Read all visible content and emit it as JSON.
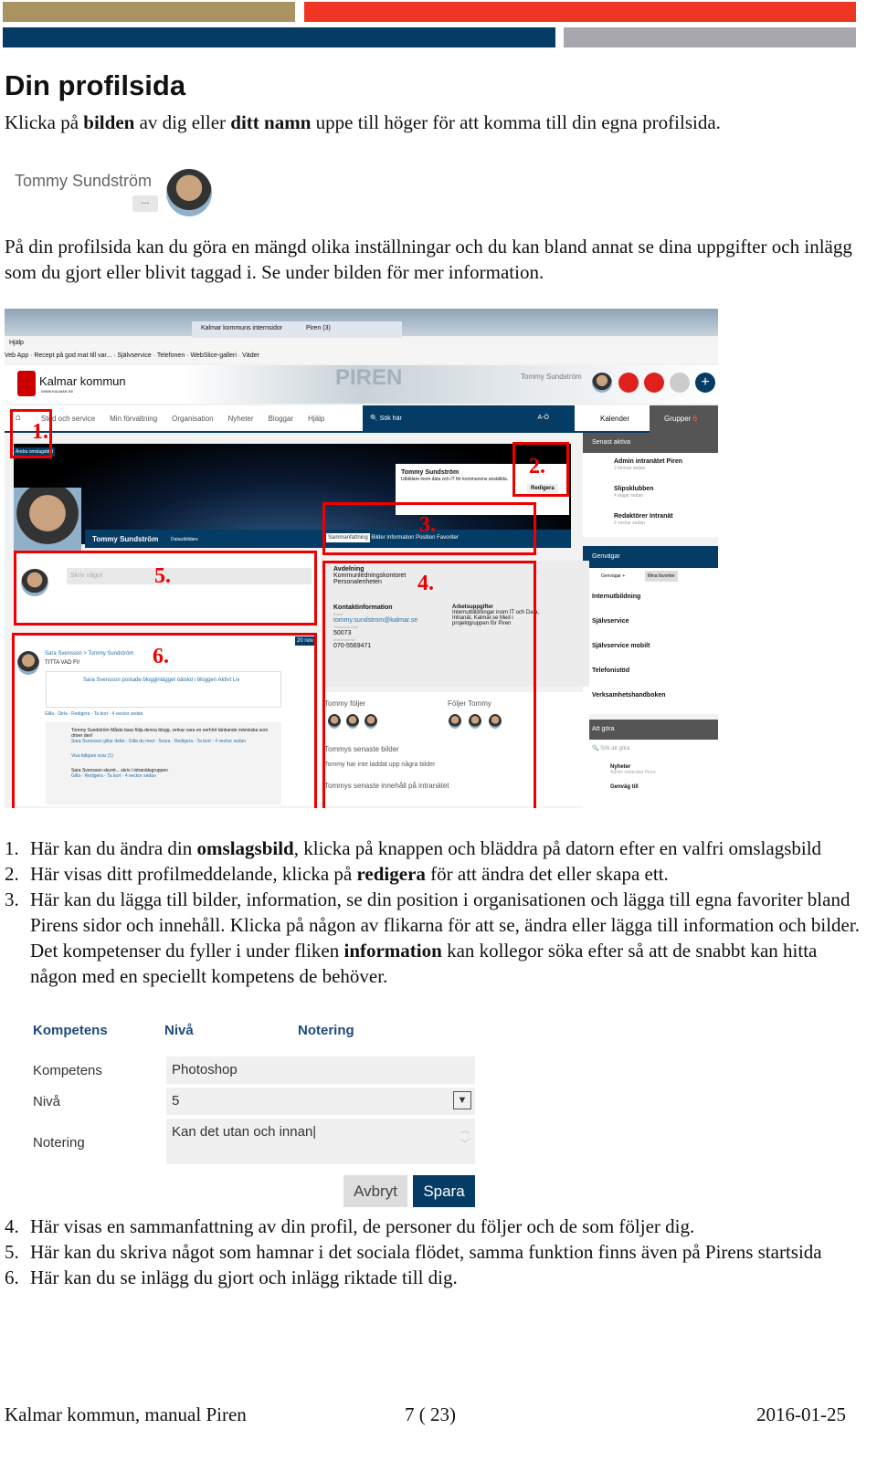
{
  "header_colors": {
    "gold": "#a89361",
    "red": "#ef3524",
    "navy": "#043c66",
    "gray": "#a7a7ad"
  },
  "title": "Din profilsida",
  "intro": {
    "p1": "Klicka på ",
    "b1": "bilden",
    "p2": " av dig eller ",
    "b2": "ditt namn",
    "p3": " uppe till höger för att komma till din egna profilsida."
  },
  "user_chip": {
    "name": "Tommy Sundström",
    "more": "..."
  },
  "para2": "På din profilsida kan du göra en mängd olika inställningar och du kan bland annat se dina uppgifter och inlägg som du gjort eller blivit taggad i. Se under bilden för mer information.",
  "screenshot": {
    "browser_tabs": [
      "Kalmar kommuns internsidor",
      "Piren (3)"
    ],
    "menu": "Hjälp",
    "favorites": [
      "Veb App",
      "Recept på god mat till var...",
      "Självservice",
      "Telefonen",
      "WebSlice-galleri",
      "Väder"
    ],
    "logo": "Kalmar kommun",
    "logo_sub": "WWW.KALMAR.SE",
    "banner": "PIREN",
    "user": "Tommy Sundström",
    "badges": [
      "7",
      "3"
    ],
    "nav": [
      "Stöd och service",
      "Min förvaltning",
      "Organisation",
      "Nyheter",
      "Bloggar",
      "Hjälp"
    ],
    "search": "Sök här",
    "ao": "A-Ö",
    "right_tabs": [
      "Kalender",
      "Grupper"
    ],
    "groups_badge": "6",
    "cover_button": "Ändra omslagsbild",
    "profile_name": "Tommy Sundström",
    "profile_title": "Datautbildare",
    "status_text": "Utbildare inom data och IT för kommunens anställda.",
    "edit": "Redigera",
    "tabs": [
      "Sammanfattning",
      "Bilder",
      "Information",
      "Position",
      "Favoriter"
    ],
    "recent_title": "Senast aktiva",
    "recent": [
      {
        "name": "Admin intranätet Piren",
        "time": "2 timmar sedan"
      },
      {
        "name": "Slipsklubben",
        "time": "4 dagar sedan"
      },
      {
        "name": "Redaktörer Intranät",
        "time": "2 veckor sedan"
      }
    ],
    "shortcuts_title": "Genvägar",
    "shortcut_tabs": [
      "Genvägar",
      "Mina favoriter"
    ],
    "shortcuts": [
      "Internutbildning",
      "Självservice",
      "Självservice mobilt",
      "Telefonistöd",
      "Verksamhetshandboken"
    ],
    "todo_title": "Att göra",
    "todo_search": "Sök att göra",
    "todo_item": "Nyheter",
    "todo_sub": "Admin intranätet Piren",
    "todo_more": "Genväg till",
    "write_placeholder": "Skriv något",
    "post_date": "20 nov",
    "post_author": "Sara Svensson > Tommy Sundström",
    "post_text": "TITTA VAD FI!",
    "shared": "Sara Svensson postade blogginlägget öälskd i bloggen Aktivt Liv",
    "actions": "Gilla - Dela - Redigera - Ta bort - 4 veckor sedan",
    "comment1": "Tommy Sundström Måste bara följa denna blogg, verkar vara en oerhört tänkande människa som driver den!",
    "comment1_actions": "Sara Svensson gillar detta - Gilla du med - Svara - Redigera - Ta bort - 4 veckor sedan",
    "earlier": "Visa tidigare svar (1)",
    "comment2": "Sara Svensson skumt... skriv i intranätsgruppen",
    "comment2_actions": "Gilla - Redigera - Ta bort - 4 veckor sedan",
    "dept_label": "Avdelning",
    "dept": [
      "Kommunledningskontoret",
      "Personalenheten"
    ],
    "contact_label": "Kontaktinformation",
    "email_label": "Epost",
    "email": "tommy.sundstrom@kalmar.se",
    "phone_label": "Telefonnummer",
    "phone": "50073",
    "mobile_label": "Mobilnummer",
    "mobile": "070-5569471",
    "tasks_label": "Arbetsuppgifter",
    "tasks": "Internutbildningar inom IT och Data, Intranät, Kalmar.se Med i projektgruppen för Piren",
    "follows": "Tommy följer",
    "followers": "Följer Tommy",
    "pics_title": "Tommys senaste bilder",
    "pics_text": "Tommy har inte laddat upp några bilder",
    "content_title": "Tommys senaste innehåll på intranätet",
    "markers": [
      "1.",
      "2.",
      "3.",
      "4.",
      "5.",
      "6."
    ]
  },
  "list1": [
    {
      "n": "1.",
      "parts": [
        "Här kan du ändra din ",
        "omslagsbild",
        ", klicka på knappen och bläddra på datorn efter en valfri omslagsbild"
      ]
    },
    {
      "n": "2.",
      "parts": [
        "Här visas ditt profilmeddelande, klicka på ",
        "redigera",
        " för att ändra det eller skapa ett."
      ]
    },
    {
      "n": "3.",
      "parts": [
        "Här kan du lägga till bilder, information, se din position i organisationen och lägga till egna favoriter bland Pirens sidor och innehåll. Klicka på någon av flikarna för att se, ändra eller lägga till information och bilder. Det kompetenser du fyller i under fliken ",
        "information",
        " kan kollegor söka efter så att de snabbt kan hitta någon med en speciellt kompetens de behöver."
      ]
    }
  ],
  "form": {
    "headers": [
      "Kompetens",
      "Nivå",
      "Notering"
    ],
    "labels": [
      "Kompetens",
      "Nivå",
      "Notering"
    ],
    "kompetens": "Photoshop",
    "niva": "5",
    "notering": "Kan det utan och innan",
    "cancel": "Avbryt",
    "save": "Spara",
    "save_color": "#043c66"
  },
  "list2": [
    {
      "n": "4.",
      "text": "Här visas en sammanfattning av din profil, de personer du följer och de som följer dig."
    },
    {
      "n": "5.",
      "text": "Här kan du skriva något som hamnar i det sociala flödet, samma funktion finns även på Pirens startsida"
    },
    {
      "n": "6.",
      "text": "Här kan du se inlägg du gjort och inlägg riktade till dig."
    }
  ],
  "footer": {
    "left": "Kalmar kommun, manual Piren",
    "center": "7 ( 23)",
    "right": "2016-01-25"
  }
}
